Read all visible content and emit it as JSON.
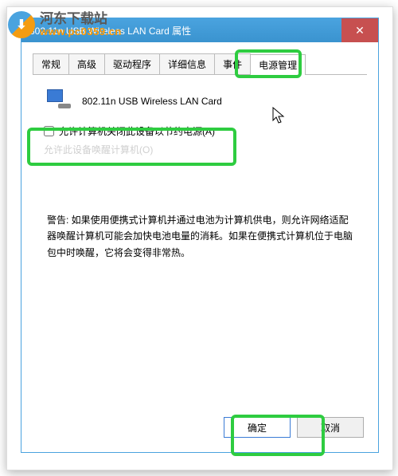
{
  "watermark": {
    "line1": "河东下载站",
    "line2": "www.pc0359.cn"
  },
  "window": {
    "title": "802.11n USB Wireless LAN Card 属性",
    "close": "✕"
  },
  "tabs": {
    "t0": "常规",
    "t1": "高级",
    "t2": "驱动程序",
    "t3": "详细信息",
    "t4": "事件",
    "t5": "电源管理"
  },
  "device": {
    "name": "802.11n USB Wireless LAN Card"
  },
  "options": {
    "allow_off": "允许计算机关闭此设备以节约电源(A)",
    "hidden": "允许此设备唤醒计算机(O)"
  },
  "warning": "警告: 如果使用便携式计算机并通过电池为计算机供电，则允许网络适配器唤醒计算机可能会加快电池电量的消耗。如果在便携式计算机位于电脑包中时唤醒，它将会变得非常热。",
  "buttons": {
    "ok": "确定",
    "cancel": "取消"
  }
}
